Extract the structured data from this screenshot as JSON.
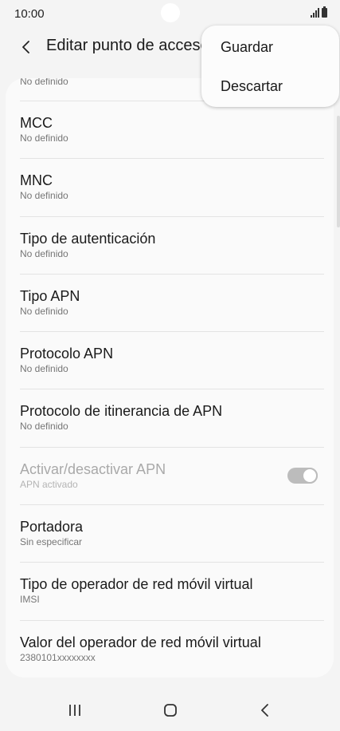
{
  "status_bar": {
    "time": "10:00",
    "icons": [
      "signal-icon",
      "battery-icon"
    ]
  },
  "header": {
    "title": "Editar punto de acceso",
    "back_icon": "back-arrow-icon"
  },
  "menu": {
    "items": [
      {
        "label": "Guardar"
      },
      {
        "label": "Descartar"
      }
    ]
  },
  "list": {
    "partial_item_subtitle": "No definido",
    "items": [
      {
        "title": "MCC",
        "subtitle": "No definido"
      },
      {
        "title": "MNC",
        "subtitle": "No definido"
      },
      {
        "title": "Tipo de autenticación",
        "subtitle": "No definido"
      },
      {
        "title": "Tipo APN",
        "subtitle": "No definido"
      },
      {
        "title": "Protocolo APN",
        "subtitle": "No definido"
      },
      {
        "title": "Protocolo de itinerancia de APN",
        "subtitle": "No definido"
      },
      {
        "title": "Activar/desactivar APN",
        "subtitle": "APN activado",
        "toggle_on": true,
        "disabled": true
      },
      {
        "title": "Portadora",
        "subtitle": "Sin especificar"
      },
      {
        "title": "Tipo de operador de red móvil virtual",
        "subtitle": "IMSI"
      },
      {
        "title": "Valor del operador de red móvil virtual",
        "subtitle": "2380101xxxxxxxx"
      }
    ]
  },
  "navigation": {
    "buttons": [
      "recent-apps-icon",
      "home-icon",
      "back-icon"
    ]
  },
  "colors": {
    "background": "#f4f4f4",
    "card": "#fafafa",
    "subtitle": "#767676",
    "disabled": "#a9a9a9",
    "toggle": "#bcbcbc"
  }
}
